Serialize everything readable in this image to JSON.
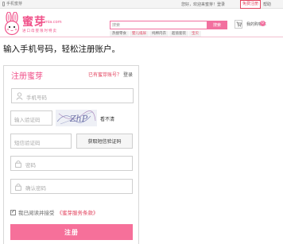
{
  "topbar": {
    "mobile": "手机蜜芽",
    "greeting": "您好，欢迎来蜜芽！登录",
    "register": "免费注册",
    "help": "帮助"
  },
  "logo": {
    "name": "蜜芽",
    "domain": "mia.com",
    "slogan": "进口母婴限时特卖"
  },
  "search": {
    "placeholder": "搜索",
    "button": "搜索",
    "hot": [
      "热搜零食",
      "婴儿纸尿",
      "纯棉内衣",
      "超值套装",
      "宝贝"
    ]
  },
  "cart": {
    "label": "我的购物车",
    "count": "0"
  },
  "caption": "输入手机号码，轻松注册账户。",
  "form": {
    "title": "注册蜜芽",
    "have_account": "已有蜜芽账号？",
    "login": "登录",
    "phone_placeholder": "手机号码",
    "captcha_placeholder": "输入验证码",
    "captcha_text": "ZhP",
    "cant_see": "看不清",
    "sms_placeholder": "短信验证码",
    "sms_button": "获取短信验证码",
    "password_placeholder": "密码",
    "confirm_placeholder": "确认密码",
    "agree_prefix": "我已阅读并接受",
    "terms": "《蜜芽服务条款》",
    "submit": "注册"
  },
  "colors": {
    "brand": "#f0528a",
    "button": "#f6709a",
    "accent": "#e2435e"
  }
}
